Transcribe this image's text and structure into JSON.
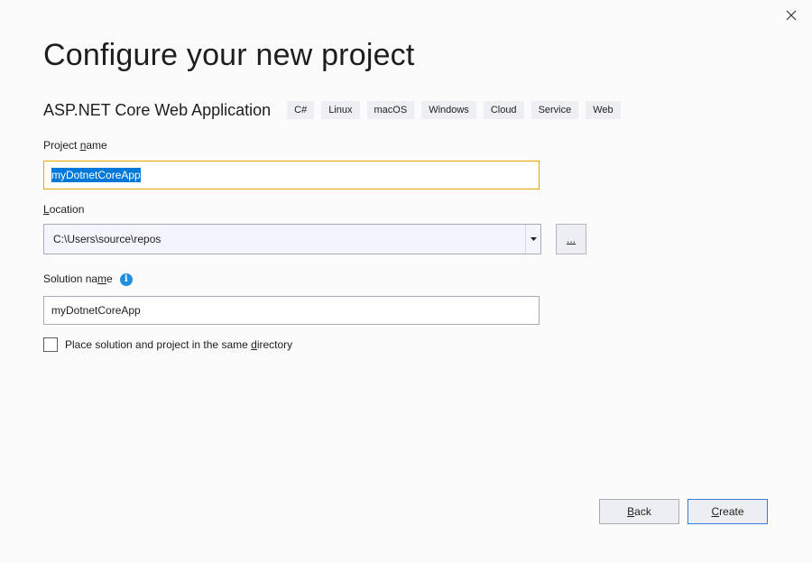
{
  "dialog": {
    "title": "Configure your new project",
    "close_icon": "close-icon"
  },
  "template": {
    "name": "ASP.NET Core Web Application",
    "tags": [
      "C#",
      "Linux",
      "macOS",
      "Windows",
      "Cloud",
      "Service",
      "Web"
    ]
  },
  "project_name": {
    "label_pre": "Project ",
    "label_access": "n",
    "label_post": "ame",
    "value": "myDotnetCoreApp"
  },
  "location": {
    "label_access": "L",
    "label_post": "ocation",
    "value": "C:\\Users\\source\\repos",
    "browse_label": "..."
  },
  "solution_name": {
    "label_pre": "Solution na",
    "label_access": "m",
    "label_post": "e",
    "info_icon": "info-icon",
    "value": "myDotnetCoreApp"
  },
  "same_directory": {
    "label_pre": "Place solution and project in the same ",
    "label_access": "d",
    "label_post": "irectory",
    "checked": false
  },
  "buttons": {
    "back_access": "B",
    "back_post": "ack",
    "create_access": "C",
    "create_post": "reate"
  },
  "colors": {
    "focus_border": "#e6a800",
    "selection": "#0078d7",
    "info": "#1f8fe0",
    "primary_border": "#3a7bd5"
  }
}
